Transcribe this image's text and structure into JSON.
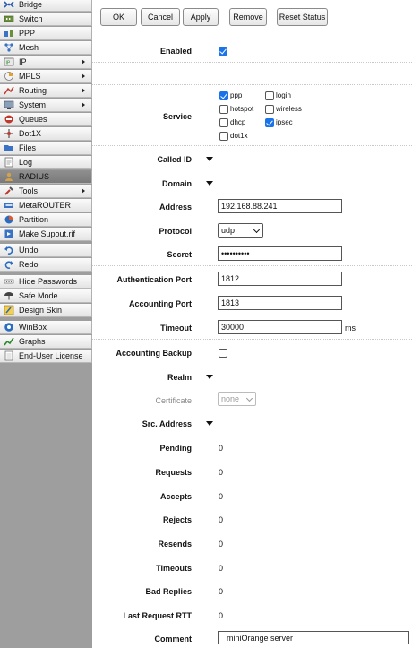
{
  "sidebar": {
    "items": [
      {
        "label": "Bridge",
        "icon": "bridge-icon",
        "has_submenu": false
      },
      {
        "label": "Switch",
        "icon": "switch-icon",
        "has_submenu": false
      },
      {
        "label": "PPP",
        "icon": "ppp-icon",
        "has_submenu": false
      },
      {
        "label": "Mesh",
        "icon": "mesh-icon",
        "has_submenu": false
      },
      {
        "label": "IP",
        "icon": "ip-icon",
        "has_submenu": true
      },
      {
        "label": "MPLS",
        "icon": "mpls-icon",
        "has_submenu": true
      },
      {
        "label": "Routing",
        "icon": "routing-icon",
        "has_submenu": true
      },
      {
        "label": "System",
        "icon": "system-icon",
        "has_submenu": true
      },
      {
        "label": "Queues",
        "icon": "queues-icon",
        "has_submenu": false
      },
      {
        "label": "Dot1X",
        "icon": "dot1x-icon",
        "has_submenu": false
      },
      {
        "label": "Files",
        "icon": "files-icon",
        "has_submenu": false
      },
      {
        "label": "Log",
        "icon": "log-icon",
        "has_submenu": false
      },
      {
        "label": "RADIUS",
        "icon": "radius-icon",
        "has_submenu": false,
        "active": true
      },
      {
        "label": "Tools",
        "icon": "tools-icon",
        "has_submenu": true
      },
      {
        "label": "MetaROUTER",
        "icon": "metarouter-icon",
        "has_submenu": false
      },
      {
        "label": "Partition",
        "icon": "partition-icon",
        "has_submenu": false
      },
      {
        "label": "Make Supout.rif",
        "icon": "supout-icon",
        "has_submenu": false
      },
      {
        "label": "Undo",
        "icon": "undo-icon",
        "has_submenu": false
      },
      {
        "label": "Redo",
        "icon": "redo-icon",
        "has_submenu": false
      },
      {
        "label": "Hide Passwords",
        "icon": "hide-passwords-icon",
        "has_submenu": false
      },
      {
        "label": "Safe Mode",
        "icon": "safe-mode-icon",
        "has_submenu": false
      },
      {
        "label": "Design Skin",
        "icon": "design-skin-icon",
        "has_submenu": false
      },
      {
        "label": "WinBox",
        "icon": "winbox-icon",
        "has_submenu": false
      },
      {
        "label": "Graphs",
        "icon": "graphs-icon",
        "has_submenu": false
      },
      {
        "label": "End-User License",
        "icon": "license-icon",
        "has_submenu": false
      }
    ]
  },
  "toolbar": {
    "ok": "OK",
    "cancel": "Cancel",
    "apply": "Apply",
    "remove": "Remove",
    "reset_status": "Reset Status"
  },
  "form": {
    "enabled": {
      "label": "Enabled",
      "checked": true
    },
    "service": {
      "label": "Service",
      "options": [
        {
          "label": "ppp",
          "checked": true
        },
        {
          "label": "login",
          "checked": false
        },
        {
          "label": "hotspot",
          "checked": false
        },
        {
          "label": "wireless",
          "checked": false
        },
        {
          "label": "dhcp",
          "checked": false
        },
        {
          "label": "ipsec",
          "checked": true
        },
        {
          "label": "dot1x",
          "checked": false
        }
      ]
    },
    "called_id": {
      "label": "Called ID"
    },
    "domain": {
      "label": "Domain"
    },
    "address": {
      "label": "Address",
      "value": "192.168.88.241"
    },
    "protocol": {
      "label": "Protocol",
      "value": "udp"
    },
    "secret": {
      "label": "Secret",
      "value": "••••••••••"
    },
    "auth_port": {
      "label": "Authentication Port",
      "value": "1812"
    },
    "acct_port": {
      "label": "Accounting Port",
      "value": "1813"
    },
    "timeout": {
      "label": "Timeout",
      "value": "30000",
      "unit": "ms"
    },
    "acct_backup": {
      "label": "Accounting Backup",
      "checked": false
    },
    "realm": {
      "label": "Realm"
    },
    "certificate": {
      "label": "Certificate",
      "value": "none"
    },
    "src_address": {
      "label": "Src. Address"
    },
    "pending": {
      "label": "Pending",
      "value": "0"
    },
    "requests": {
      "label": "Requests",
      "value": "0"
    },
    "accepts": {
      "label": "Accepts",
      "value": "0"
    },
    "rejects": {
      "label": "Rejects",
      "value": "0"
    },
    "resends": {
      "label": "Resends",
      "value": "0"
    },
    "timeouts": {
      "label": "Timeouts",
      "value": "0"
    },
    "bad_replies": {
      "label": "Bad Replies",
      "value": "0"
    },
    "last_request_rtt": {
      "label": "Last Request RTT",
      "value": "0"
    },
    "comment": {
      "label": "Comment",
      "value": "miniOrange server"
    }
  },
  "colors": {
    "accent": "#1a73e8",
    "sidebar_bg": "#9e9e9e",
    "active_item": "#7f7f7f"
  }
}
